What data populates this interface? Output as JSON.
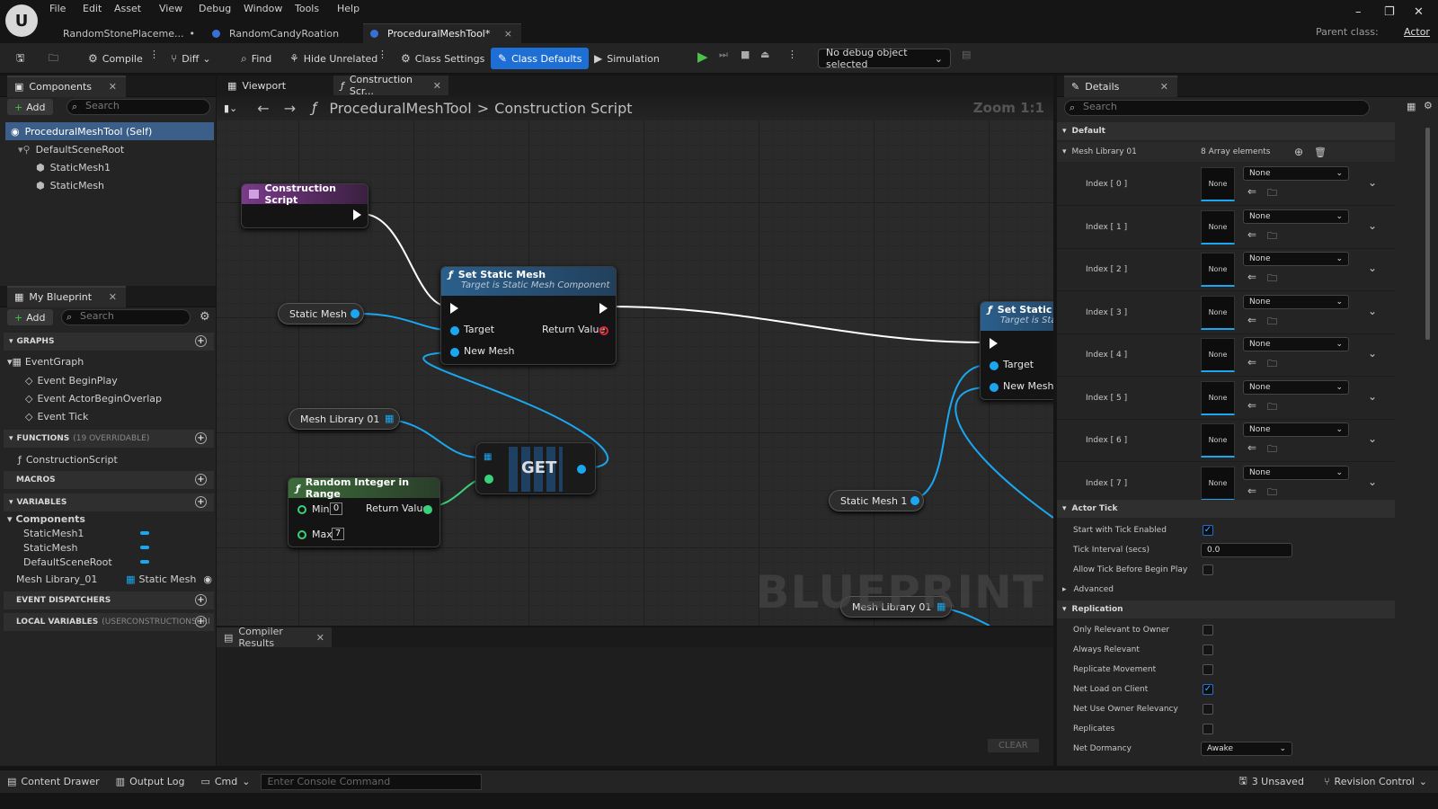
{
  "menu": [
    "File",
    "Edit",
    "Asset",
    "View",
    "Debug",
    "Window",
    "Tools",
    "Help"
  ],
  "tabs": [
    {
      "label": "RandomStonePlaceme...",
      "suffix": "•"
    },
    {
      "label": "RandomCandyRoation",
      "suffix": ""
    },
    {
      "label": "ProceduralMeshTool*",
      "suffix": "×"
    }
  ],
  "parent_class_label": "Parent class:",
  "parent_class_value": "Actor",
  "toolbar": {
    "compile": "Compile",
    "diff": "Diff",
    "find": "Find",
    "hide_unrelated": "Hide Unrelated",
    "class_settings": "Class Settings",
    "class_defaults": "Class Defaults",
    "simulation": "Simulation",
    "debug_object": "No debug object selected"
  },
  "components_panel": {
    "title": "Components",
    "add": "Add",
    "search_placeholder": "Search",
    "tree": [
      "ProceduralMeshTool (Self)",
      "DefaultSceneRoot",
      "StaticMesh1",
      "StaticMesh"
    ]
  },
  "my_blueprint": {
    "title": "My Blueprint",
    "add": "Add",
    "search_placeholder": "Search",
    "graphs_label": "GRAPHS",
    "event_graph": "EventGraph",
    "events": [
      "Event BeginPlay",
      "Event ActorBeginOverlap",
      "Event Tick"
    ],
    "functions_label": "FUNCTIONS",
    "functions_sub": "(19 OVERRIDABLE)",
    "construction_script": "ConstructionScript",
    "macros_label": "MACROS",
    "variables_label": "VARIABLES",
    "components_label": "Components",
    "component_vars": [
      "StaticMesh1",
      "StaticMesh",
      "DefaultSceneRoot"
    ],
    "mesh_library_var": "Mesh Library_01",
    "mesh_library_type": "Static Mesh",
    "event_dispatchers_label": "EVENT DISPATCHERS",
    "local_vars_label": "LOCAL VARIABLES",
    "local_vars_sub": "(USERCONSTRUCTIONSCRI"
  },
  "graph_tabs": {
    "viewport": "Viewport",
    "construction": "Construction Scr..."
  },
  "graph": {
    "breadcrumb_1": "ProceduralMeshTool",
    "breadcrumb_sep": ">",
    "breadcrumb_2": "Construction Script",
    "zoom": "Zoom 1:1",
    "construction_script_node": "Construction Script",
    "set_static_mesh_title": "Set Static Mesh",
    "set_static_mesh_sub": "Target is Static Mesh Component",
    "set_static_mesh2_title": "Set Static M",
    "set_static_mesh2_sub": "Target is Stat",
    "target": "Target",
    "new_mesh": "New Mesh",
    "return_value": "Return Value",
    "static_mesh_var": "Static Mesh",
    "static_mesh1_var": "Static Mesh 1",
    "mesh_library_var": "Mesh Library 01",
    "get_label": "GET",
    "random_int_title": "Random Integer in Range",
    "min": "Min",
    "max": "Max",
    "min_val": "0",
    "max_val": "7",
    "watermark": "BLUEPRINT"
  },
  "compiler": {
    "title": "Compiler Results",
    "clear": "CLEAR"
  },
  "details": {
    "title": "Details",
    "search_placeholder": "Search",
    "default_label": "Default",
    "mesh_library": "Mesh Library 01",
    "array_count": "8 Array elements",
    "indices": [
      "Index [ 0 ]",
      "Index [ 1 ]",
      "Index [ 2 ]",
      "Index [ 3 ]",
      "Index [ 4 ]",
      "Index [ 5 ]",
      "Index [ 6 ]",
      "Index [ 7 ]"
    ],
    "none": "None",
    "actor_tick": "Actor Tick",
    "start_tick": "Start with Tick Enabled",
    "tick_interval": "Tick Interval (secs)",
    "tick_interval_val": "0.0",
    "allow_tick": "Allow Tick Before Begin Play",
    "advanced": "Advanced",
    "replication": "Replication",
    "only_relevant": "Only Relevant to Owner",
    "always_relevant": "Always Relevant",
    "replicate_movement": "Replicate Movement",
    "net_load": "Net Load on Client",
    "net_use_owner": "Net Use Owner Relevancy",
    "replicates": "Replicates",
    "net_dormancy": "Net Dormancy",
    "net_dormancy_val": "Awake"
  },
  "statusbar": {
    "content_drawer": "Content Drawer",
    "output_log": "Output Log",
    "cmd": "Cmd",
    "console_placeholder": "Enter Console Command",
    "unsaved": "3 Unsaved",
    "revision": "Revision Control"
  }
}
